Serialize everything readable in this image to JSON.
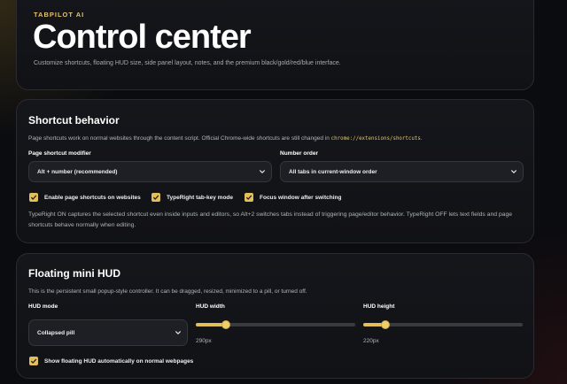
{
  "hero": {
    "brand": "TABPILOT AI",
    "title": "Control center",
    "subtitle": "Customize shortcuts, floating HUD size, side panel layout, notes, and the premium black/gold/red/blue interface."
  },
  "shortcut": {
    "title": "Shortcut behavior",
    "desc_prefix": "Page shortcuts work on normal websites through the content script. Official Chrome-wide shortcuts are still changed in ",
    "desc_code": "chrome://extensions/shortcuts",
    "desc_suffix": ".",
    "modifier_label": "Page shortcut modifier",
    "modifier_value": "Alt + number (recommended)",
    "order_label": "Number order",
    "order_value": "All tabs in current-window order",
    "check_enable": "Enable page shortcuts on websites",
    "check_typeright": "TypeRight tab-key mode",
    "check_focus": "Focus window after switching",
    "paragraph": "TypeRight ON captures the selected shortcut even inside inputs and editors, so Alt+2 switches tabs instead of triggering page/editor behavior. TypeRight OFF lets text fields and page shortcuts behave normally when editing."
  },
  "hud": {
    "title": "Floating mini HUD",
    "desc": "This is the persistent small popup-style controller. It can be dragged, resized, minimized to a pill, or turned off.",
    "mode_label": "HUD mode",
    "mode_value": "Collapsed pill",
    "width_label": "HUD width",
    "width_value": "290px",
    "width_fraction": 0.17,
    "height_label": "HUD height",
    "height_value": "220px",
    "height_fraction": 0.12,
    "check_show": "Show floating HUD automatically on normal webpages"
  },
  "colors": {
    "accent_gold": "#e2bf58",
    "background": "#0b0c10"
  }
}
